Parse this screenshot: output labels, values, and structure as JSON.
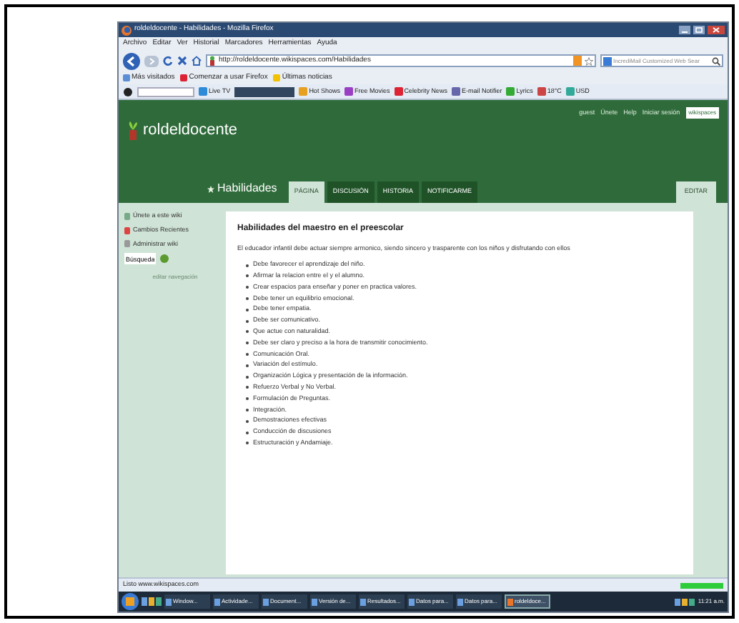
{
  "window": {
    "title": "roldeldocente - Habilidades - Mozilla Firefox"
  },
  "menu": [
    "Archivo",
    "Editar",
    "Ver",
    "Historial",
    "Marcadores",
    "Herramientas",
    "Ayuda"
  ],
  "address": {
    "value": "http://roldeldocente.wikispaces.com/Habilidades"
  },
  "search": {
    "placeholder": "IncrediMail Customized Web Sear"
  },
  "bookmarks": [
    "Más visitados",
    "Comenzar a usar Firefox",
    "Últimas noticias"
  ],
  "toolbar": [
    "Live TV",
    "Hot Shows",
    "Free Movies",
    "Celebrity News",
    "E-mail Notifier",
    "Lyrics",
    "18°C",
    "USD"
  ],
  "wiki": {
    "name": "roldeldocente",
    "user_links": [
      "guest",
      "Únete",
      "Help",
      "Iniciar sesión"
    ],
    "badge": "wikispaces",
    "page_title": "Habilidades"
  },
  "tabs": [
    {
      "label": "PÁGINA",
      "selected": true
    },
    {
      "label": "DISCUSIÓN",
      "selected": false
    },
    {
      "label": "HISTORIA",
      "selected": false
    },
    {
      "label": "NOTIFICARME",
      "selected": false
    }
  ],
  "edit_button": "EDITAR",
  "sidebar": {
    "items": [
      "Únete a este wiki",
      "Cambios Recientes",
      "Administrar wiki"
    ],
    "search_value": "Búsqueda",
    "edit_link": "editar navegación"
  },
  "content": {
    "heading": "Habilidades del maestro en el preescolar",
    "intro": "El educador infantil debe actuar siempre armonico, siendo sincero y trasparente con los niños y disfrutando con ellos",
    "items": [
      "Debe favorecer el aprendizaje del niño.",
      "Afirmar la relacion entre el y el alumno.",
      "Crear espacios para enseñar y poner en practica valores.",
      "Debe tener un equilibrio emocional.",
      "Debe tener empatia.",
      "Debe ser comunicativo.",
      "Que actue con naturalidad.",
      "Debe ser claro y preciso a la hora de transmitir conocimiento.",
      "Comunicación Oral.",
      "Variación del estímulo.",
      "Organización Lógica y presentación de la información.",
      "Refuerzo Verbal y No Verbal.",
      "Formulación de Preguntas.",
      "Integración.",
      "Demostraciones efectivas",
      "Conducción de discusiones",
      "Estructuración y Andamiaje."
    ]
  },
  "status_bar": {
    "text": "Listo www.wikispaces.com",
    "level": 1
  },
  "taskbar": [
    {
      "label": "Window...",
      "selected": false
    },
    {
      "label": "Actividade...",
      "selected": false
    },
    {
      "label": "Document...",
      "selected": false
    },
    {
      "label": "Versión de...",
      "selected": false
    },
    {
      "label": "Resultados...",
      "selected": false
    },
    {
      "label": "Datos para...",
      "selected": false
    },
    {
      "label": "Datos para...",
      "selected": false
    },
    {
      "label": "roldeldoce...",
      "selected": true
    }
  ],
  "clock": "11:21 a.m."
}
